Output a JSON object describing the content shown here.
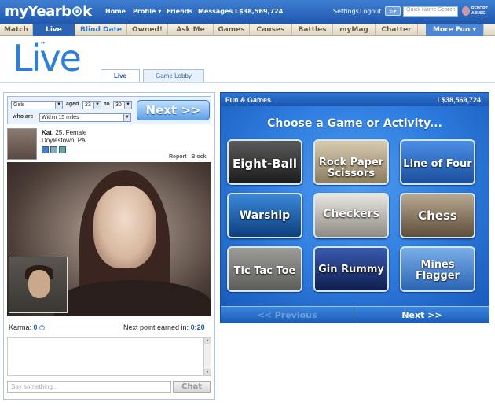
{
  "topbar": {
    "logo": "myYearb⊙k",
    "nav": [
      "Home",
      "Profile ▾",
      "Friends",
      "Messages",
      "L$38,569,724"
    ],
    "settings": "Settings",
    "logout": "Logout",
    "search_glyph": "⌕▾",
    "search_placeholder": "Quick Name Search",
    "report_abuse": "REPORT ABUSE!"
  },
  "tabs": [
    "Match",
    "Live",
    "Blind Date",
    "Owned!",
    "Ask Me",
    "Games",
    "Causes",
    "Battles",
    "myMag",
    "Chatter",
    "More Fun ▾"
  ],
  "live": {
    "logo": "Live",
    "logo_dots": "••",
    "subtabs": [
      "Live",
      "Game Lobby"
    ]
  },
  "filter": {
    "gender": "Girls",
    "aged_label": "aged",
    "age_min": "23",
    "to_label": "to",
    "age_max": "30",
    "who_label": "who are",
    "distance": "Within 15 miles",
    "next_label": "Next >>"
  },
  "profile": {
    "name": "Kat",
    "details": ", 25, Female",
    "location": "Doylestown, PA",
    "report": "Report",
    "separator": " | ",
    "block": "Block"
  },
  "karma": {
    "label": "Karma: ",
    "value": "0",
    "help": "?",
    "next_point_label": "Next point earned in: ",
    "next_point_value": "0:20"
  },
  "chat": {
    "placeholder": "Say something...",
    "button": "Chat",
    "scroll_up": "▲",
    "scroll_down": "▼"
  },
  "games_panel": {
    "title": "Fun & Games",
    "credits": "L$38,569,724",
    "heading": "Choose a Game or Activity...",
    "games": [
      {
        "label": "Eight-Ball"
      },
      {
        "label1": "Rock Paper",
        "label2": "Scissors"
      },
      {
        "label": "Line of Four"
      },
      {
        "label": "Warship"
      },
      {
        "label": "Checkers"
      },
      {
        "label": "Chess"
      },
      {
        "label": "Tic Tac Toe"
      },
      {
        "label": "Gin Rummy"
      },
      {
        "label1": "Mines",
        "label2": "Flagger"
      }
    ],
    "prev_label": "<< Previous",
    "next_label": "Next >>"
  },
  "colors": {
    "brand_blue": "#1f58ad",
    "live_blue": "#2e7fd8",
    "panel_blue": "#1d62c6"
  }
}
